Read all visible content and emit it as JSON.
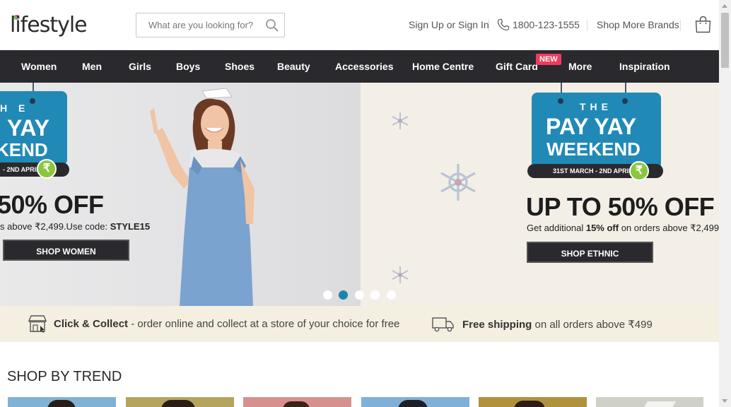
{
  "header": {
    "logo_text": "lifestyle",
    "search_placeholder": "What are you looking for?",
    "sign_in": "Sign Up or Sign In",
    "phone": "1800-123-1555",
    "more_brands": "Shop More Brands"
  },
  "nav": {
    "items": [
      "Women",
      "Men",
      "Girls",
      "Boys",
      "Shoes",
      "Beauty",
      "Accessories",
      "Home Centre",
      "Gift Card",
      "More",
      "Inspiration"
    ],
    "new_badge": "NEW"
  },
  "banner": {
    "left": {
      "tag_the": "H E",
      "tag_line1": "YAY",
      "tag_line2": "KEND",
      "date": "- 2ND APRIL",
      "offer": "50% OFF",
      "sub_prefix": "s above ₹2,499.Use code: ",
      "sub_code": "STYLE15",
      "cta": "SHOP WOMEN"
    },
    "right": {
      "tag_the": "THE",
      "tag_line1": "PAY YAY",
      "tag_line2": "WEEKEND",
      "date": "31ST MARCH - 2ND APRIL",
      "offer": "UP TO 50% OFF",
      "sub_prefix": "Get additional ",
      "sub_bold": "15% off",
      "sub_suffix": " on orders above ₹2,499",
      "cta": "SHOP ETHNIC"
    },
    "rupee_symbol": "₹",
    "active_slide": 2,
    "slide_count": 5
  },
  "strip": {
    "click_collect_bold": "Click & Collect",
    "click_collect_rest": " - order online and collect at a store of your choice for free",
    "free_shipping_bold": "Free shipping",
    "free_shipping_rest": " on all orders above ₹499"
  },
  "trend": {
    "title": "SHOP BY TREND"
  },
  "colors": {
    "nav_bg": "#2a2a2e",
    "accent_blue": "#2189b6",
    "badge_red": "#f13b5c",
    "strip_bg": "#f4efe1",
    "dot_active": "#1b86a8"
  },
  "icons": {
    "search": "search-icon",
    "phone": "phone-icon",
    "bag": "shopping-bag-icon",
    "store": "store-icon",
    "truck": "truck-icon",
    "snowflake": "snowflake-icon"
  }
}
